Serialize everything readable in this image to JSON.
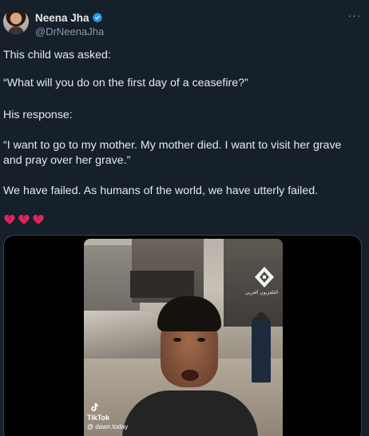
{
  "author": {
    "display_name": "Neena Jha",
    "handle": "@DrNeenaJha",
    "verified": true,
    "avatar_icon": "profile-photo"
  },
  "more_icon": "more-horizontal-icon",
  "tweet": {
    "paragraphs": [
      "This child was asked:",
      "“What will you do on the first day of a ceasefire?”",
      "His response:",
      "“I want to go to my mother. My mother died. I want to visit her grave and pray over her grave.”",
      "We have failed. As humans of the world, we have utterly failed."
    ],
    "emoji": [
      "broken-heart-icon",
      "broken-heart-icon",
      "broken-heart-icon"
    ]
  },
  "media": {
    "type": "video",
    "tiktok_label": "TikTok",
    "tiktok_user": "@ dawn.today",
    "watermark_caption": "التلفزيون العربي"
  },
  "colors": {
    "background": "#15202b",
    "text": "#e7e9ea",
    "secondary": "#8b98a5",
    "verified": "#1d9bf0",
    "heart": "#e0245e"
  }
}
